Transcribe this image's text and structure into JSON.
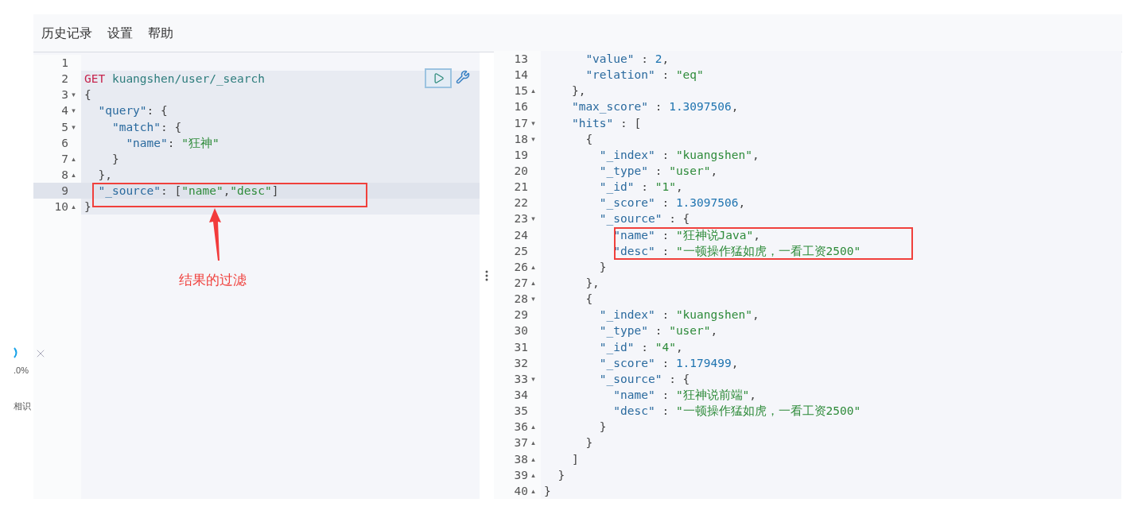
{
  "menu": [
    "历史记录",
    "设置",
    "帮助"
  ],
  "side_fragments": [
    ".0%",
    "相识"
  ],
  "request_editor": {
    "lines": [
      {
        "number": "1",
        "highlighted": false,
        "selected": false
      },
      {
        "number": "2",
        "highlighted": true,
        "selected": false,
        "tokens": [
          {
            "kind": "method",
            "text": "GET"
          },
          {
            "kind": "path",
            "text": " kuangshen/user/_search"
          }
        ]
      },
      {
        "number": "3",
        "fold": "▾",
        "highlighted": true,
        "selected": false,
        "tokens": [
          {
            "kind": "punct",
            "text": "{"
          }
        ]
      },
      {
        "number": "4",
        "fold": "▾",
        "highlighted": true,
        "selected": false,
        "tokens": [
          {
            "kind": "key",
            "text": "  \"query\""
          },
          {
            "kind": "punct",
            "text": ": {"
          }
        ]
      },
      {
        "number": "5",
        "fold": "▾",
        "highlighted": true,
        "selected": false,
        "tokens": [
          {
            "kind": "key",
            "text": "    \"match\""
          },
          {
            "kind": "punct",
            "text": ": {"
          }
        ]
      },
      {
        "number": "6",
        "highlighted": true,
        "selected": false,
        "tokens": [
          {
            "kind": "key",
            "text": "      \"name\""
          },
          {
            "kind": "punct",
            "text": ": "
          },
          {
            "kind": "string",
            "text": "\"狂神\""
          }
        ]
      },
      {
        "number": "7",
        "fold": "▴",
        "highlighted": true,
        "selected": false,
        "tokens": [
          {
            "kind": "punct",
            "text": "    }"
          }
        ]
      },
      {
        "number": "8",
        "fold": "▴",
        "highlighted": true,
        "selected": false,
        "tokens": [
          {
            "kind": "punct",
            "text": "  },"
          }
        ]
      },
      {
        "number": "9",
        "highlighted": true,
        "selected": true,
        "tokens": [
          {
            "kind": "key",
            "text": "  \"_source\""
          },
          {
            "kind": "punct",
            "text": ": ["
          },
          {
            "kind": "string",
            "text": "\"name\""
          },
          {
            "kind": "punct",
            "text": ","
          },
          {
            "kind": "string",
            "text": "\"desc\""
          },
          {
            "kind": "punct",
            "text": "]"
          }
        ]
      },
      {
        "number": "10",
        "fold": "▴",
        "highlighted": true,
        "selected": false,
        "tokens": [
          {
            "kind": "punct",
            "text": "}"
          }
        ]
      }
    ]
  },
  "annotation": {
    "label": "结果的过滤"
  },
  "response_viewer": {
    "lines": [
      {
        "number": "13",
        "tokens": [
          {
            "kind": "key",
            "text": "      \"value\""
          },
          {
            "kind": "punct",
            "text": " : "
          },
          {
            "kind": "number",
            "text": "2"
          },
          {
            "kind": "punct",
            "text": ","
          }
        ]
      },
      {
        "number": "14",
        "tokens": [
          {
            "kind": "key",
            "text": "      \"relation\""
          },
          {
            "kind": "punct",
            "text": " : "
          },
          {
            "kind": "string",
            "text": "\"eq\""
          }
        ]
      },
      {
        "number": "15",
        "fold": "▴",
        "tokens": [
          {
            "kind": "punct",
            "text": "    },"
          }
        ]
      },
      {
        "number": "16",
        "tokens": [
          {
            "kind": "key",
            "text": "    \"max_score\""
          },
          {
            "kind": "punct",
            "text": " : "
          },
          {
            "kind": "number",
            "text": "1.3097506"
          },
          {
            "kind": "punct",
            "text": ","
          }
        ]
      },
      {
        "number": "17",
        "fold": "▾",
        "tokens": [
          {
            "kind": "key",
            "text": "    \"hits\""
          },
          {
            "kind": "punct",
            "text": " : ["
          }
        ]
      },
      {
        "number": "18",
        "fold": "▾",
        "tokens": [
          {
            "kind": "punct",
            "text": "      {"
          }
        ]
      },
      {
        "number": "19",
        "tokens": [
          {
            "kind": "key",
            "text": "        \"_index\""
          },
          {
            "kind": "punct",
            "text": " : "
          },
          {
            "kind": "string",
            "text": "\"kuangshen\""
          },
          {
            "kind": "punct",
            "text": ","
          }
        ]
      },
      {
        "number": "20",
        "tokens": [
          {
            "kind": "key",
            "text": "        \"_type\""
          },
          {
            "kind": "punct",
            "text": " : "
          },
          {
            "kind": "string",
            "text": "\"user\""
          },
          {
            "kind": "punct",
            "text": ","
          }
        ]
      },
      {
        "number": "21",
        "tokens": [
          {
            "kind": "key",
            "text": "        \"_id\""
          },
          {
            "kind": "punct",
            "text": " : "
          },
          {
            "kind": "string",
            "text": "\"1\""
          },
          {
            "kind": "punct",
            "text": ","
          }
        ]
      },
      {
        "number": "22",
        "tokens": [
          {
            "kind": "key",
            "text": "        \"_score\""
          },
          {
            "kind": "punct",
            "text": " : "
          },
          {
            "kind": "number",
            "text": "1.3097506"
          },
          {
            "kind": "punct",
            "text": ","
          }
        ]
      },
      {
        "number": "23",
        "fold": "▾",
        "tokens": [
          {
            "kind": "key",
            "text": "        \"_source\""
          },
          {
            "kind": "punct",
            "text": " : {"
          }
        ]
      },
      {
        "number": "24",
        "tokens": [
          {
            "kind": "key",
            "text": "          \"name\""
          },
          {
            "kind": "punct",
            "text": " : "
          },
          {
            "kind": "string",
            "text": "\"狂神说Java\""
          },
          {
            "kind": "punct",
            "text": ","
          }
        ]
      },
      {
        "number": "25",
        "tokens": [
          {
            "kind": "key",
            "text": "          \"desc\""
          },
          {
            "kind": "punct",
            "text": " : "
          },
          {
            "kind": "string",
            "text": "\"一顿操作猛如虎，一看工资2500\""
          }
        ]
      },
      {
        "number": "26",
        "fold": "▴",
        "tokens": [
          {
            "kind": "punct",
            "text": "        }"
          }
        ]
      },
      {
        "number": "27",
        "fold": "▴",
        "tokens": [
          {
            "kind": "punct",
            "text": "      },"
          }
        ]
      },
      {
        "number": "28",
        "fold": "▾",
        "tokens": [
          {
            "kind": "punct",
            "text": "      {"
          }
        ]
      },
      {
        "number": "29",
        "tokens": [
          {
            "kind": "key",
            "text": "        \"_index\""
          },
          {
            "kind": "punct",
            "text": " : "
          },
          {
            "kind": "string",
            "text": "\"kuangshen\""
          },
          {
            "kind": "punct",
            "text": ","
          }
        ]
      },
      {
        "number": "30",
        "tokens": [
          {
            "kind": "key",
            "text": "        \"_type\""
          },
          {
            "kind": "punct",
            "text": " : "
          },
          {
            "kind": "string",
            "text": "\"user\""
          },
          {
            "kind": "punct",
            "text": ","
          }
        ]
      },
      {
        "number": "31",
        "tokens": [
          {
            "kind": "key",
            "text": "        \"_id\""
          },
          {
            "kind": "punct",
            "text": " : "
          },
          {
            "kind": "string",
            "text": "\"4\""
          },
          {
            "kind": "punct",
            "text": ","
          }
        ]
      },
      {
        "number": "32",
        "tokens": [
          {
            "kind": "key",
            "text": "        \"_score\""
          },
          {
            "kind": "punct",
            "text": " : "
          },
          {
            "kind": "number",
            "text": "1.179499"
          },
          {
            "kind": "punct",
            "text": ","
          }
        ]
      },
      {
        "number": "33",
        "fold": "▾",
        "tokens": [
          {
            "kind": "key",
            "text": "        \"_source\""
          },
          {
            "kind": "punct",
            "text": " : {"
          }
        ]
      },
      {
        "number": "34",
        "tokens": [
          {
            "kind": "key",
            "text": "          \"name\""
          },
          {
            "kind": "punct",
            "text": " : "
          },
          {
            "kind": "string",
            "text": "\"狂神说前端\""
          },
          {
            "kind": "punct",
            "text": ","
          }
        ]
      },
      {
        "number": "35",
        "tokens": [
          {
            "kind": "key",
            "text": "          \"desc\""
          },
          {
            "kind": "punct",
            "text": " : "
          },
          {
            "kind": "string",
            "text": "\"一顿操作猛如虎，一看工资2500\""
          }
        ]
      },
      {
        "number": "36",
        "fold": "▴",
        "tokens": [
          {
            "kind": "punct",
            "text": "        }"
          }
        ]
      },
      {
        "number": "37",
        "fold": "▴",
        "tokens": [
          {
            "kind": "punct",
            "text": "      }"
          }
        ]
      },
      {
        "number": "38",
        "fold": "▴",
        "tokens": [
          {
            "kind": "punct",
            "text": "    ]"
          }
        ]
      },
      {
        "number": "39",
        "fold": "▴",
        "tokens": [
          {
            "kind": "punct",
            "text": "  }"
          }
        ]
      },
      {
        "number": "40",
        "fold": "▴",
        "tokens": [
          {
            "kind": "punct",
            "text": "}"
          }
        ]
      }
    ]
  }
}
